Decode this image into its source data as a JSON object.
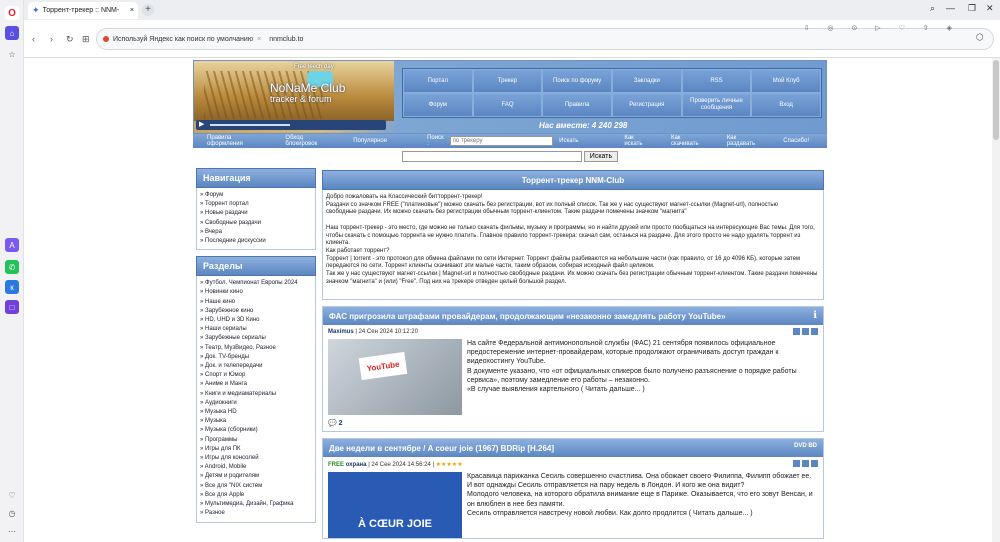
{
  "browser": {
    "tab_title": "Торрент-трекер :: NNM-",
    "url_hint": "Используй Яндекс как поиск по умолчанию",
    "url": "nnmclub.to"
  },
  "banner": {
    "leech_day": "Free leech day",
    "logo_line1": "NoNaMe Club",
    "logo_line2": "tracker & forum",
    "members_label": "Нас вместе: 4 240 298"
  },
  "menu": {
    "row1": [
      "Портал",
      "Трекер",
      "Поиск по форуму",
      "Закладки",
      "RSS",
      "Мой Клуб"
    ],
    "row2": [
      "Форум",
      "FAQ",
      "Правила",
      "Регистрация",
      "Проверить личные сообщения",
      "Вход"
    ]
  },
  "subbar": {
    "links": [
      "Правила оформления",
      "Обход блокировок",
      "Популярное"
    ],
    "search_label": "Поиск :",
    "search_placeholder": "по трекеру",
    "search_btn": "Искать",
    "right_links": [
      "Как искать",
      "Как скачивать",
      "Как раздавать",
      "Спасибо!"
    ]
  },
  "search2": {
    "button": "Искать"
  },
  "nav_panel": {
    "title": "Навигация",
    "items": [
      "» Форум",
      "» Торрент портал",
      "» Новые раздачи",
      "» Свободные раздачи",
      "» Вчера",
      "» Последние дискуссии"
    ]
  },
  "sections_panel": {
    "title": "Разделы",
    "items": [
      "» Футбол. Чемпионат Европы 2024",
      "» Новинки кино",
      "» Наше кино",
      "» Зарубежное кино",
      "» HD, UHD и 3D Кино",
      "» Наши сериалы",
      "» Зарубежные сериалы",
      "» Театр, МузВидео, Разное",
      "» Док. TV-бренды",
      "» Док. и телепередачи",
      "» Спорт и Юмор",
      "» Аниме и Манга",
      "» Книги и медиаматериалы",
      "» Аудиокниги",
      "» Музыка HD",
      "» Музыка",
      "» Музыка (сборники)",
      "» Программы",
      "» Игры для ПК",
      "» Игры для консолей",
      "» Android, Mobile",
      "» Детям и родителям",
      "» Все для \"NIX систем",
      "» Все для Apple",
      "» Мультимедиа, Дизайн, Графика",
      "» Разное"
    ]
  },
  "main": {
    "title": "Торрент-трекер NNM-Club",
    "welcome": [
      "Добро пожаловать на Классический битторрент-трекер!",
      "Раздачи со значком FREE (\"платиновые\") можно скачать без регистрации, вот их полный список. Так же у нас существуют магнет-ссылки (Magnet-url), полностью",
      "свободные раздачи. Их можно скачать без регистрации обычным торрент-клиентом. Такие раздачи помечены значком \"магнита\"",
      "",
      "Наш торрент-трекер - это место, где можно не только скачать фильмы, музыку и программы, но и найти друзей или просто пообщаться на интересующие Вас темы. Для того, чтобы скачать с помощью торрента не нужно платить. Главное правило торрент-трекера: скачал сам, останься на раздаче. Для этого просто не надо удалять торрент из клиента.",
      "Как работает торрент?",
      "Торрент | torrent - это протокол для обмена файлами по сети Интернет. Торрент файлы разбиваются на небольшие части (как правило, от 16 до 4096 КБ), которые затем передаются по сети. Торрент клиенты скачивают эти малые части, таким образом, собирая исходный файл целиком.",
      "Так же у нас существуют магнет-ссылки | Magnet-url и полностью свободные раздачи. Их можно скачать без регистрации обычным торрент-клиентом. Такие раздачи помечены значком \"магнита\" и (или) \"Free\". Под них на трекере отведен целый большой раздел."
    ]
  },
  "news1": {
    "title": "ФАС пригрозила штрафами провайдерам, продолжающим «незаконно замедлять работу YouTube»",
    "author": "Maximus",
    "date": "| 24 Сен 2024 10:12:20",
    "thumb_text": "YouTube",
    "text": [
      "На сайте Федеральной антимонопольной службы (ФАС) 21 сентября появилось официальное предостережение интернет-провайдерам, которые продолжают ограничивать доступ граждан к видеохостингу YouTube.",
      "В документе указано, что «от официальных спикеров было получено разъяснение о порядке работы сервиса», поэтому замедление его работы – незаконно.",
      "«В случае выявления картельного ( Читать дальше... )"
    ],
    "comments": "2"
  },
  "news2": {
    "title": "Две недели в сентябре / A coeur joie (1967) BDRip [H.264]",
    "badge": "DVD BD",
    "free": "FREE",
    "author": "охрана",
    "date": "| 24 Сен 2024 14:56:24 |",
    "stars": "★★★★★",
    "thumb_text": "À CŒUR JOIE",
    "text": [
      "Красавица парижанка Сесиль совершенно счастлива. Она обожает своего Филиппа, Филипп обожает ее. И вот однажды Сесиль отправляется на пару недель в Лондон. И кого же она видит?",
      "Молодого человека, на которого обратила внимание еще в Париже. Оказывается, что его зовут Венсан, и он влюблен в нее без памяти.",
      "Сесиль отправляется навстречу новой любви. Как долго продлится ( Читать дальше... )"
    ]
  }
}
